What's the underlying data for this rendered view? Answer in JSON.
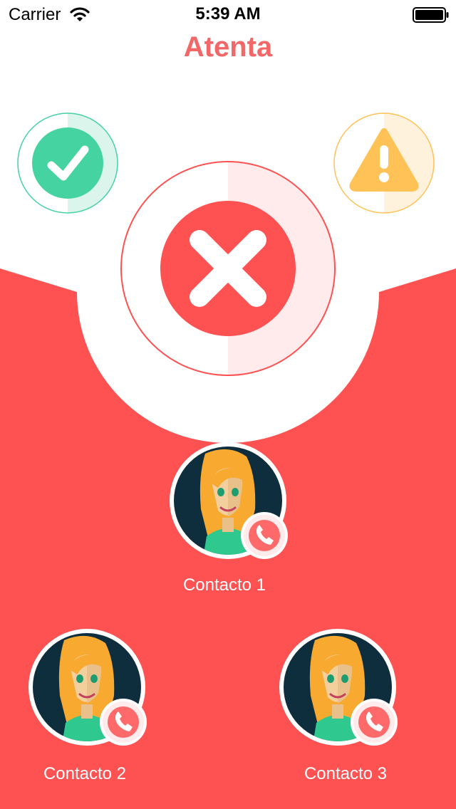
{
  "status_bar": {
    "carrier": "Carrier",
    "time": "5:39 AM"
  },
  "app": {
    "title": "Atenta"
  },
  "colors": {
    "accent_red": "#fe5252",
    "title_red": "#f26767",
    "ok_green": "#45d3a1",
    "warn_yellow": "#fec257",
    "avatar_bg": "#0e2e3e"
  },
  "status_buttons": [
    {
      "name": "ok",
      "icon": "checkmark-icon"
    },
    {
      "name": "danger",
      "icon": "close-x-icon",
      "selected": true
    },
    {
      "name": "warning",
      "icon": "warning-icon"
    }
  ],
  "contacts": [
    {
      "label": "Contacto 1",
      "icon": "phone-icon"
    },
    {
      "label": "Contacto 2",
      "icon": "phone-icon"
    },
    {
      "label": "Contacto 3",
      "icon": "phone-icon"
    }
  ]
}
